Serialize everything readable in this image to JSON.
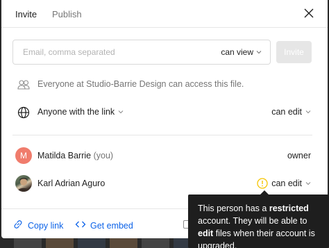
{
  "tabs": {
    "invite": "Invite",
    "publish": "Publish"
  },
  "invite_form": {
    "email_placeholder": "Email, comma separated",
    "email_value": "",
    "permission": "can view",
    "invite_button": "Invite"
  },
  "org_access": {
    "text": "Everyone at Studio-Barrie Design can access this file.",
    "icon": "people-icon"
  },
  "link_access": {
    "label": "Anyone with the link",
    "permission": "can edit",
    "icon": "globe-icon"
  },
  "members": [
    {
      "initial": "M",
      "name": "Matilda Barrie",
      "suffix": "(you)",
      "role": "owner",
      "avatar_color": "#f07c6c"
    },
    {
      "name": "Karl Adrian Aguro",
      "role": "can edit",
      "warning_icon": "warning-icon"
    }
  ],
  "footer": {
    "copy_link": "Copy link",
    "get_embed": "Get embed"
  },
  "tooltip": {
    "part1": "This person has a ",
    "bold1": "restricted",
    "part2": " account. They will be able to ",
    "bold2": "edit",
    "part3": " files when their account is upgraded."
  },
  "colors": {
    "accent_link": "#0d63e8",
    "warning": "#f5c400",
    "tooltip_bg": "#1e1e1e",
    "invite_disabled": "#e6e6e6"
  }
}
